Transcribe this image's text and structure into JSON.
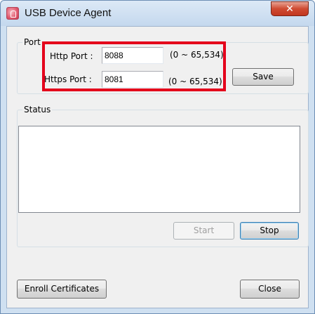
{
  "window": {
    "title": "USB Device Agent",
    "close_glyph": "✕",
    "icon": "usb-agent-app-icon"
  },
  "port_group": {
    "label": "Port",
    "http": {
      "label": "Http Port :",
      "value": "8088",
      "range": "(0 ~ 65,534)"
    },
    "https": {
      "label": "Https Port :",
      "value": "8081",
      "range": "(0 ~ 65,534)"
    },
    "save_label": "Save"
  },
  "status_group": {
    "label": "Status",
    "log_text": "",
    "start_label": "Start",
    "stop_label": "Stop"
  },
  "footer": {
    "enroll_label": "Enroll Certificates",
    "close_label": "Close"
  },
  "colors": {
    "highlight": "#e4001b",
    "close_button": "#c2371f"
  }
}
